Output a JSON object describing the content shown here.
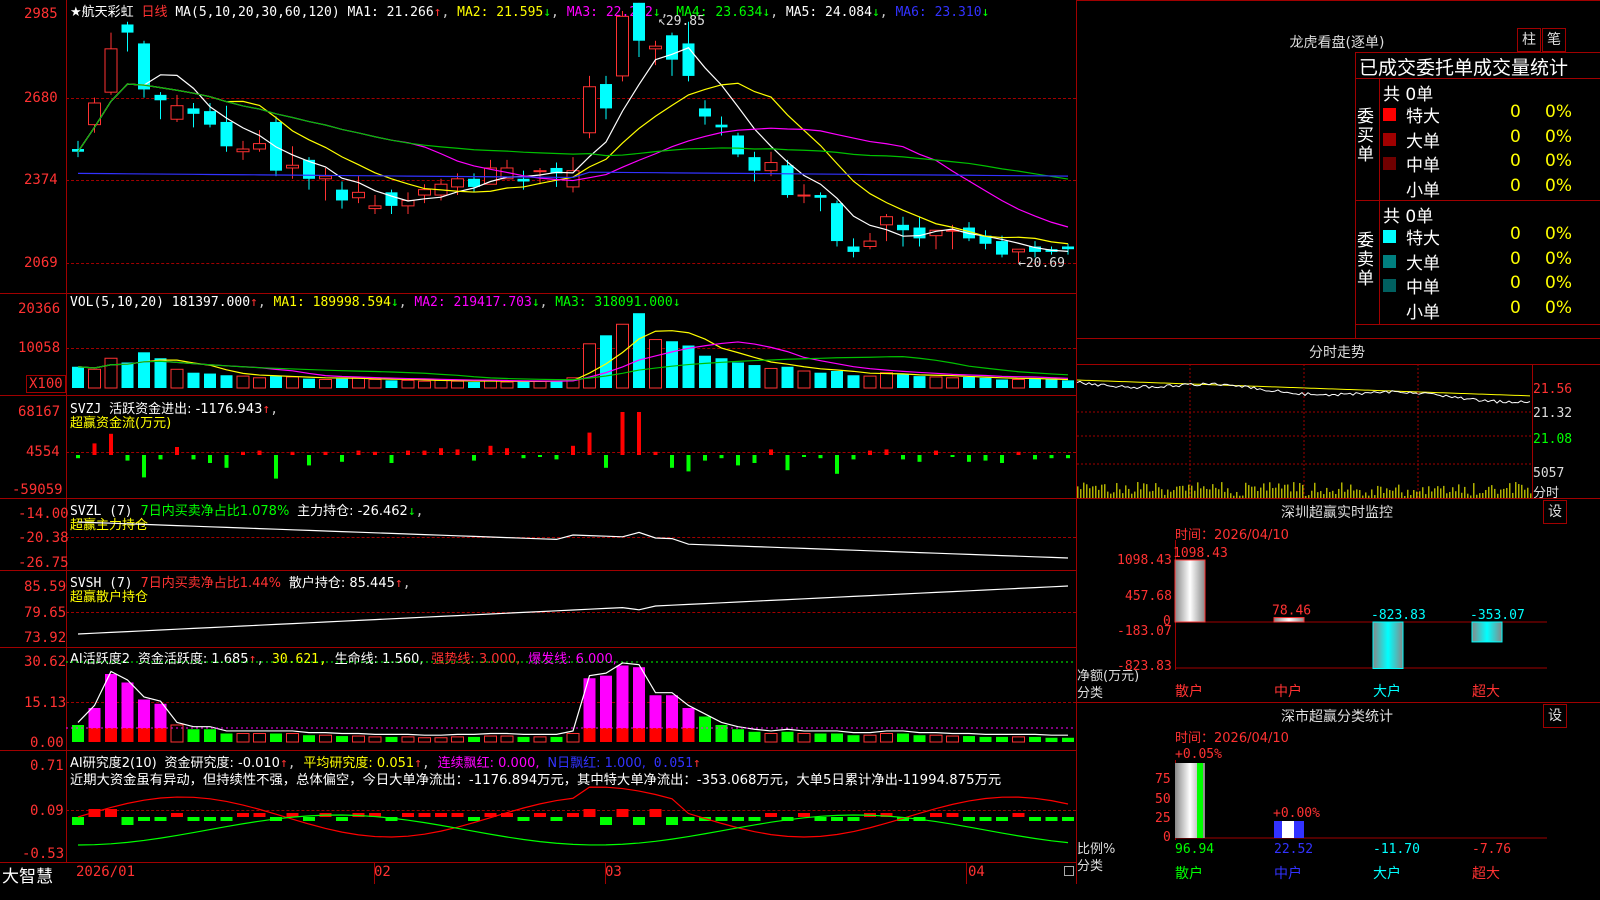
{
  "title": {
    "name": "航天彩虹",
    "period": "日线"
  },
  "ma_line": {
    "label": "MA(5,10,20,30,60,120)",
    "ma1": "MA1: 21.266",
    "ma2": "MA2: 21.595",
    "ma3": "MA3: 22.202",
    "ma4": "MA4: 23.634",
    "ma5": "MA5: 24.084",
    "ma6": "MA6: 23.310"
  },
  "price_axis": [
    "2985",
    "2680",
    "2374",
    "2069"
  ],
  "high_label": "29.85",
  "low_label": "20.69",
  "vol_line": {
    "label": "VOL(5,10,20)",
    "v": "181397.000",
    "ma1": "MA1: 189998.594",
    "ma2": "MA2: 219417.703",
    "ma3": "MA3: 318091.000"
  },
  "vol_axis": [
    "20366",
    "10058",
    "X100"
  ],
  "svzj": {
    "label": "SVZJ",
    "text": "活跃资金进出: -1176.943",
    "sub": "超赢资金流(万元)",
    "axis": [
      "68167",
      "4554",
      "-59059"
    ]
  },
  "svzl": {
    "label": "SVZL (7)",
    "text1": "7日内买卖净占比1.078%",
    "text2": "主力持仓: -26.462",
    "sub": "超赢主力持仓",
    "axis": [
      "-14.00",
      "-20.38",
      "-26.75"
    ]
  },
  "svsh": {
    "label": "SVSH (7)",
    "text1": "7日内买卖净占比1.44%",
    "text2": "散户持仓: 85.445",
    "sub": "超赢散户持仓",
    "axis": [
      "85.59",
      "79.65",
      "73.92"
    ]
  },
  "ai1": {
    "label": "AI活跃度2",
    "t1": "资金活跃度: 1.685",
    "t2": "30.621,",
    "t3": "生命线: 1.560,",
    "t4": "强势线: 3.000,",
    "t5": "爆发线: 6.000,",
    "axis": [
      "30.62",
      "15.13",
      "0.00"
    ]
  },
  "ai2": {
    "label": "AI研究度2(10)",
    "t1": "资金研究度: -0.010",
    "t2": "平均研究度: 0.051",
    "t3": "连续飘红: 0.000,",
    "t4": "N日飘红: 1.000,",
    "t5": "0.051",
    "comment": "近期大资金虽有异动，但持续性不强，总体偏空，今日大单净流出：-1176.894万元，其中特大单净流出：-353.068万元，大单5日累计净出-11994.875万元",
    "axis": [
      "0.71",
      "0.09",
      "-0.53"
    ]
  },
  "date_axis": [
    "2026/01",
    "02",
    "03",
    "04"
  ],
  "brand": "大智慧",
  "right": {
    "lhkp": "龙虎看盘(逐单)",
    "btn_zhu": "柱",
    "btn_bi": "笔",
    "stat_title": "已成交委托单成交量统计",
    "buy_label": "委买单",
    "sell_label": "委卖单",
    "buy_total": "共 0单",
    "sell_total": "共 0单",
    "buy_rows": [
      {
        "name": "特大",
        "n": "0",
        "p": "0%",
        "color": "#ff0000"
      },
      {
        "name": "大单",
        "n": "0",
        "p": "0%",
        "color": "#a00000"
      },
      {
        "name": "中单",
        "n": "0",
        "p": "0%",
        "color": "#700000"
      },
      {
        "name": "小单",
        "n": "0",
        "p": "0%",
        "color": ""
      }
    ],
    "sell_rows": [
      {
        "name": "特大",
        "n": "0",
        "p": "0%",
        "color": "#00ffff"
      },
      {
        "name": "大单",
        "n": "0",
        "p": "0%",
        "color": "#008080"
      },
      {
        "name": "中单",
        "n": "0",
        "p": "0%",
        "color": "#006060"
      },
      {
        "name": "小单",
        "n": "0",
        "p": "0%",
        "color": ""
      }
    ],
    "fenshi": "分时走势",
    "fenshi_axis": [
      "21.56",
      "21.32",
      "21.08",
      "5057",
      "分时"
    ],
    "monitor_title": "深圳超赢实时监控",
    "btn_set": "设",
    "time_label": "时间：2026/04/10",
    "monitor_axis": [
      "1098.43",
      "457.68",
      "0",
      "-183.07",
      "-823.83"
    ],
    "monitor_ylabel": "净额(万元)",
    "monitor_xlabel": "分类",
    "monitor_values": [
      {
        "cat": "散户",
        "v": "1098.43",
        "val": 1098.43
      },
      {
        "cat": "中户",
        "v": "78.46",
        "val": 78.46
      },
      {
        "cat": "大户",
        "v": "-823.83",
        "val": -823.83
      },
      {
        "cat": "超大",
        "v": "-353.07",
        "val": -353.07
      }
    ],
    "stat2_title": "深市超赢分类统计",
    "stat2_axis": [
      "75",
      "50",
      "25",
      "0"
    ],
    "stat2_ylabel": "比例%",
    "stat2_xlabel": "分类",
    "stat2_top": [
      "+0.05%",
      "+0.00%"
    ],
    "stat2_values": [
      {
        "cat": "散户",
        "v": "96.94"
      },
      {
        "cat": "中户",
        "v": "22.52"
      },
      {
        "cat": "大户",
        "v": "-11.70"
      },
      {
        "cat": "超大",
        "v": "-7.76"
      }
    ]
  },
  "colors": {
    "up": "#ff3232",
    "down": "#00ffff",
    "frame": "#a00000",
    "text": "#c0c0c0"
  }
}
